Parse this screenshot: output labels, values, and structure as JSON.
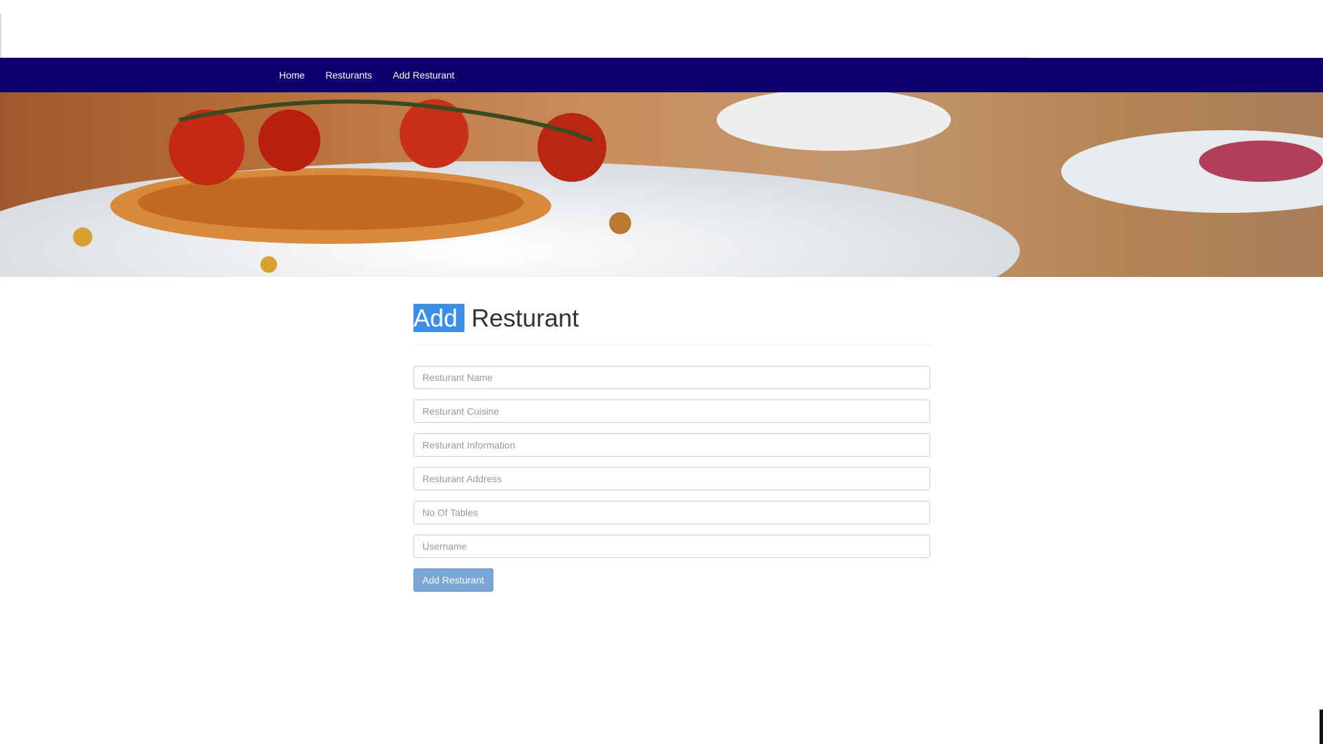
{
  "nav": {
    "items": [
      {
        "label": "Home"
      },
      {
        "label": "Resturants"
      },
      {
        "label": "Add Resturant"
      }
    ],
    "background_color": "#0d006e"
  },
  "hero": {
    "image": "food-banner-image"
  },
  "main": {
    "title_highlight": "Add",
    "title_rest": "Resturant",
    "highlight_color": "#3b8fe6",
    "form": {
      "fields": [
        {
          "placeholder": "Resturant Name",
          "value": ""
        },
        {
          "placeholder": "Resturant Cuisine",
          "value": ""
        },
        {
          "placeholder": "Resturant Information",
          "value": ""
        },
        {
          "placeholder": "Resturant Address",
          "value": ""
        },
        {
          "placeholder": "No Of Tables",
          "value": ""
        },
        {
          "placeholder": "Username",
          "value": ""
        }
      ],
      "submit_label": "Add Resturant",
      "submit_color": "#7aa6d6"
    }
  }
}
